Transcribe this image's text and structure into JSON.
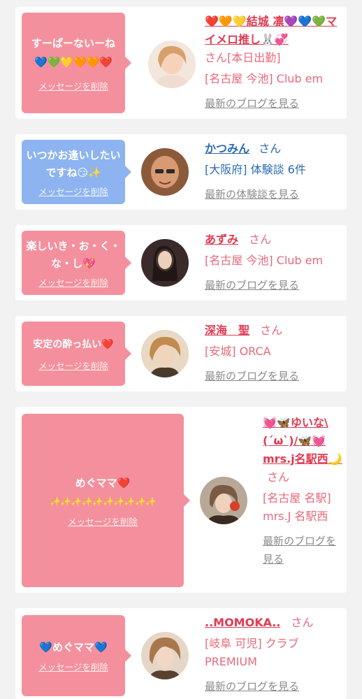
{
  "cards": [
    {
      "message": "すーぱーないーね💙💚💛🧡🧡❤️",
      "delete_label": "メッセージを削除",
      "name": "❤️🧡💛結城 凛💜💙💚マイメロ推し🐰💞",
      "suffix": "さん[本日出勤]",
      "shop": "[名古屋 今池] Club em",
      "blog": "最新のブログを見る",
      "avatar_icon": "avatar-photo",
      "bubble_color": "#f4909d"
    },
    {
      "message": "いつかお逢いしたいですね😏✨",
      "delete_label": "メッセージを削除",
      "name": "かつみん",
      "suffix": "さん",
      "shop": "[大阪府] 体験談 6件",
      "blog": "最新の体験談を見る",
      "avatar_icon": "avatar-photo",
      "bubble_color": "#8db4f0"
    },
    {
      "message": "楽しいき・お・く・な・し💖",
      "delete_label": "メッセージを削除",
      "name": "あずみ",
      "suffix": "さん",
      "shop": "[名古屋 今池] Club em",
      "blog": "最新のブログを見る",
      "avatar_icon": "avatar-photo",
      "bubble_color": "#f4909d"
    },
    {
      "message": "安定の酔っ払い❤️",
      "delete_label": "メッセージを削除",
      "name": "深海　聖",
      "suffix": "さん",
      "shop": "[安城] ORCA",
      "blog": "最新のブログを見る",
      "avatar_icon": "avatar-photo",
      "bubble_color": "#f4909d"
    },
    {
      "message_line1": "めぐママ❤️",
      "message_line2": "✨✨✨✨✨✨✨✨✨✨",
      "delete_label": "メッセージを削除",
      "name": "💓🦋ゆいな\\(´ω`)/🦋💓mrs.j名駅西🌙",
      "suffix": "さん",
      "shop": "[名古屋 名駅] mrs.J 名駅西",
      "blog": "最新のブログを見る",
      "avatar_icon": "avatar-photo",
      "bubble_color": "#f4909d"
    },
    {
      "message": "💙めぐママ💙",
      "delete_label": "メッセージを削除",
      "name": "..MOMOKA..",
      "suffix": "さん",
      "shop": "[岐阜 可児] クラブ PREMIUM",
      "blog": "最新のブログを見る",
      "avatar_icon": "avatar-photo",
      "bubble_color": "#f4909d"
    }
  ]
}
